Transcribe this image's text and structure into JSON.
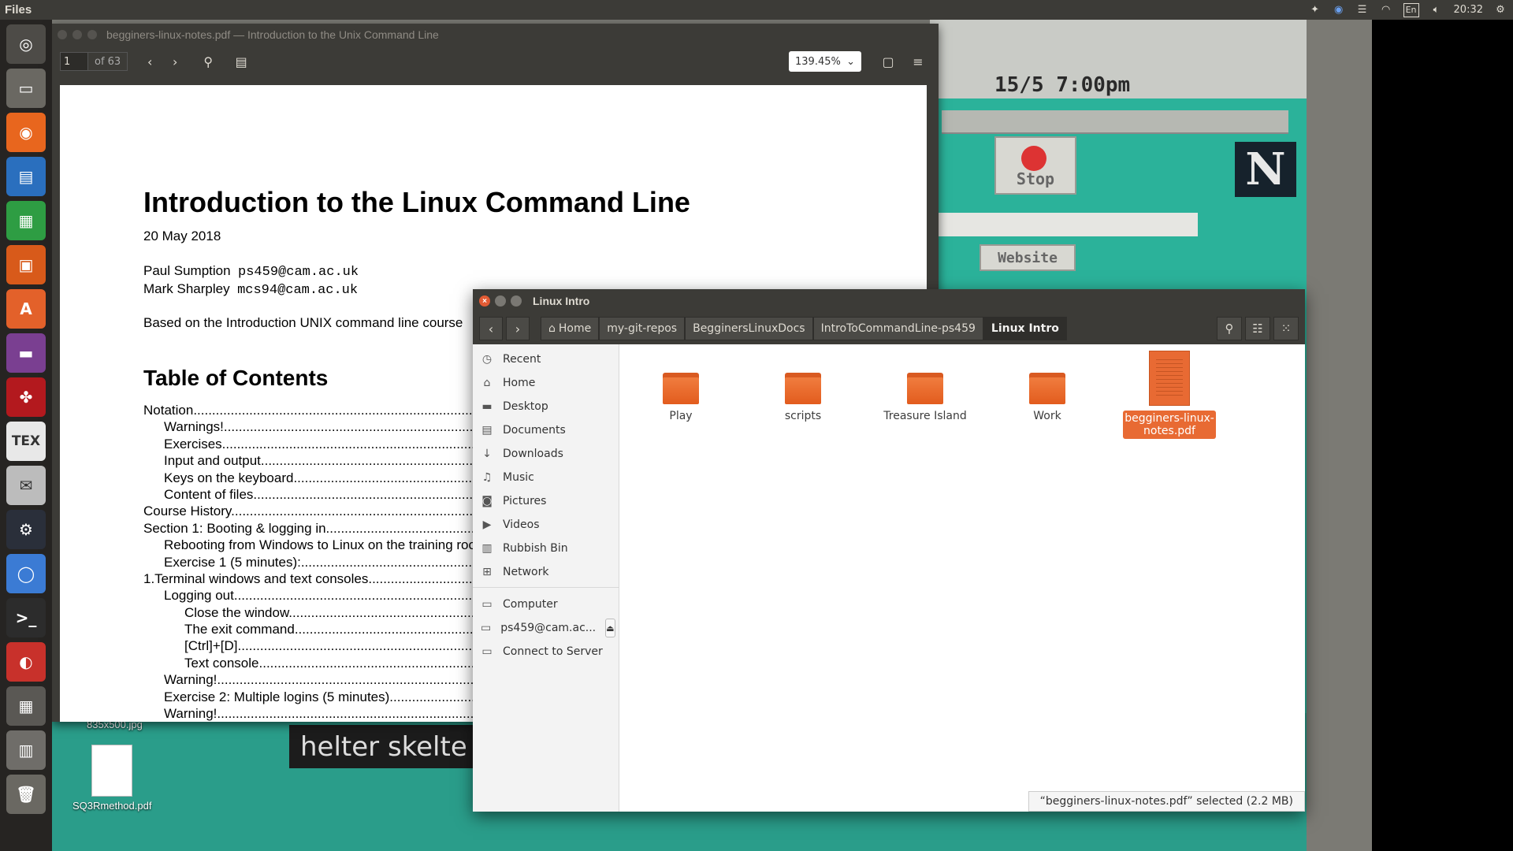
{
  "top_panel": {
    "app_name": "Files",
    "indicators": {
      "language": "En",
      "time": "20:32"
    }
  },
  "launcher": {
    "items": [
      {
        "name": "ubuntu-dash",
        "color": "#4d4b47"
      },
      {
        "name": "files",
        "color": "#6a6862"
      },
      {
        "name": "firefox",
        "color": "#e8661e"
      },
      {
        "name": "writer",
        "color": "#2a6fbe"
      },
      {
        "name": "calc",
        "color": "#2e9d43"
      },
      {
        "name": "impress",
        "color": "#d85a1a"
      },
      {
        "name": "software-center",
        "color": "#e3612a"
      },
      {
        "name": "workspaces",
        "color": "#7a3f91"
      },
      {
        "name": "mendeley",
        "color": "#b3191e"
      },
      {
        "name": "texmaker",
        "color": "#e8e8e8",
        "glyph": "TEX"
      },
      {
        "name": "mail",
        "color": "#bcbcbc"
      },
      {
        "name": "steam",
        "color": "#2a2f3a"
      },
      {
        "name": "chromium",
        "color": "#3b7bd4"
      },
      {
        "name": "terminal",
        "color": "#2c2c2c",
        "glyph": ">_"
      },
      {
        "name": "evince",
        "color": "#c8312b"
      },
      {
        "name": "workspace-switcher",
        "color": "#5a5854"
      },
      {
        "name": "unity-tweak",
        "color": "#6f6d69"
      },
      {
        "name": "trash",
        "color": "#6a6862"
      }
    ]
  },
  "desktop": {
    "icons": [
      {
        "label": "835x500.jpg"
      },
      {
        "label": "SQ3Rmethod.pdf"
      }
    ],
    "wallpaper_text": {
      "clock": "15/5 7:00pm",
      "stop": "Stop",
      "website": "Website",
      "helter": "helter skelte",
      "netscape": "N"
    }
  },
  "pdf_viewer": {
    "title": "begginers-linux-notes.pdf — Introduction to the Unix Command Line",
    "page_current": "1",
    "page_total": "of 63",
    "zoom": "139.45%",
    "document": {
      "title": "Introduction to the Linux Command Line",
      "date": "20 May 2018",
      "authors": [
        {
          "name": "Paul Sumption",
          "email": "ps459@cam.ac.uk"
        },
        {
          "name": "Mark Sharpley",
          "email": "mcs94@cam.ac.uk"
        }
      ],
      "based_on": "Based on the Introduction UNIX command line course",
      "toc_heading": "Table of Contents",
      "toc": [
        {
          "level": 1,
          "text": "Notation............................................................................................................"
        },
        {
          "level": 2,
          "text": "Warnings!.........................................................................................................."
        },
        {
          "level": 2,
          "text": "Exercises.........................................................................................................."
        },
        {
          "level": 2,
          "text": "Input and output................................................................................................."
        },
        {
          "level": 2,
          "text": "Keys on the keyboard........................................................................................"
        },
        {
          "level": 2,
          "text": "Content of files.................................................................................................."
        },
        {
          "level": 1,
          "text": "Course History...................................................................................................."
        },
        {
          "level": 1,
          "text": "Section 1: Booting & logging in..........................................................................."
        },
        {
          "level": 2,
          "text": "Rebooting from Windows to Linux on the training room computers................."
        },
        {
          "level": 2,
          "text": "Exercise 1 (5 minutes):......................................................................................."
        },
        {
          "level": 1,
          "text": "1.Terminal windows and text consoles................................................................"
        },
        {
          "level": 2,
          "text": "Logging out........................................................................................................"
        },
        {
          "level": 3,
          "text": "Close the window............................................................................................."
        },
        {
          "level": 3,
          "text": "The exit command............................................................................................"
        },
        {
          "level": 3,
          "text": "[Ctrl]+[D]............................................................................................................"
        },
        {
          "level": 3,
          "text": "Text console........................................................................................................"
        },
        {
          "level": 2,
          "text": "Warning!............................................................................................................"
        },
        {
          "level": 2,
          "text": "Exercise 2: Multiple logins (5 minutes)..............................................................."
        },
        {
          "level": 2,
          "text": "Warning!............................................................................................................"
        }
      ]
    }
  },
  "file_manager": {
    "title": "Linux Intro",
    "breadcrumbs": [
      "Home",
      "my-git-repos",
      "BegginersLinuxDocs",
      "IntroToCommandLine-ps459",
      "Linux Intro"
    ],
    "sidebar": {
      "places": [
        {
          "label": "Recent",
          "icon": "clock-icon"
        },
        {
          "label": "Home",
          "icon": "home-icon"
        },
        {
          "label": "Desktop",
          "icon": "folder-icon"
        },
        {
          "label": "Documents",
          "icon": "document-icon"
        },
        {
          "label": "Downloads",
          "icon": "download-icon"
        },
        {
          "label": "Music",
          "icon": "music-icon"
        },
        {
          "label": "Pictures",
          "icon": "camera-icon"
        },
        {
          "label": "Videos",
          "icon": "video-icon"
        },
        {
          "label": "Rubbish Bin",
          "icon": "trash-icon"
        },
        {
          "label": "Network",
          "icon": "network-icon"
        }
      ],
      "devices": [
        {
          "label": "Computer",
          "icon": "drive-icon"
        },
        {
          "label": "ps459@cam.ac...",
          "icon": "drive-icon"
        },
        {
          "label": "Connect to Server",
          "icon": "server-icon"
        }
      ]
    },
    "items": [
      {
        "label": "Play",
        "type": "folder"
      },
      {
        "label": "scripts",
        "type": "folder"
      },
      {
        "label": "Treasure Island",
        "type": "folder"
      },
      {
        "label": "Work",
        "type": "folder"
      },
      {
        "label": "begginers-linux-notes.pdf",
        "type": "pdf",
        "selected": true
      }
    ],
    "status": "“begginers-linux-notes.pdf” selected  (2.2 MB)"
  }
}
